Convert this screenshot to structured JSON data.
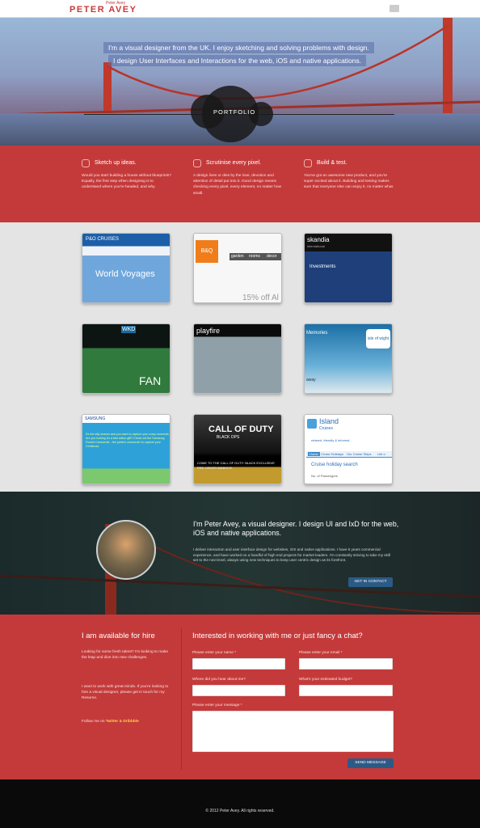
{
  "header": {
    "tagline": "Peter Avey",
    "logo": "PETER AVEY"
  },
  "hero": {
    "line1": "I'm a visual designer from the UK. I enjoy sketching and solving problems with design.",
    "line2": "I design User Interfaces and Interactions for the web, iOS and native applications.",
    "portfolio_label": "PORTFOLIO"
  },
  "features": [
    {
      "title": "Sketch up ideas.",
      "text": "Would you start building a house without blueprints? Equally, the first step when designing is to understand where you're headed, and why."
    },
    {
      "title": "Scrutinise every pixel.",
      "text": "A design lives or dies by the love, devotion and attention of detail put into it. Good design means checking every pixel, every element, no matter how small."
    },
    {
      "title": "Build & test.",
      "text": "You've got an awesome new product, and you're super excited about it. Building and testing makes sure that everyone else can enjoy it, no matter what."
    }
  ],
  "gallery": {
    "po": {
      "brand": "P&O CRUISES",
      "title": "World Voyages"
    },
    "bq": {
      "logo": "B&Q",
      "nav": [
        "garden",
        "rooms",
        "decor"
      ],
      "offer": "15% off Al"
    },
    "skandia": {
      "brand": "skandia",
      "sub": "international",
      "head": "Investments"
    },
    "wkd": {
      "logo": "WKD",
      "banner": "FAN"
    },
    "playfire": {
      "brand": "playfire"
    },
    "wight": {
      "heading": "Memories",
      "badge": "isle of wight",
      "sub": "away"
    },
    "samsung": {
      "brand": "SAMSUNG",
      "text": "It's the silly season and you want to capture your crazy moments. Are you looking for a fast action gift? Check out the Samsung Pocket Camcorder - the perfect camcorder to capture your Christmas."
    },
    "cod": {
      "title": "CALL OF DUTY",
      "sub": "BLACK OPS",
      "band": "COME TO THE CALL OF DUTY: BLACK EXCLUSIVE PRE-ORDER WEBSITE"
    },
    "island": {
      "brand": "Island",
      "brand2": "Cruises",
      "tagline": "relaxed, friendly & informal",
      "tabs": [
        "Home",
        "Cruise Holidays",
        "Our Cruise Ships",
        "Life o"
      ],
      "search": "Cruise holiday search",
      "passengers": "No. of Passengers"
    }
  },
  "about": {
    "heading": "I'm Peter Avey, a visual designer. I design UI and IxD for the web, iOS and native applications.",
    "body": "I deliver interaction and user interface design for websites, iOS and native applications. I have 5 years commercial experience, and have worked on a handful of high end projects for market leaders. I'm constantly striving to take my skill set to the next level, always using new techniques to keep user centric design as its forefront.",
    "button": "GET IN CONTACT"
  },
  "contact": {
    "left_title": "I am available for hire",
    "p1": "Looking for some fresh talent? I'm looking to make the leap and dive into new challenges.",
    "p2": "I want to work with great minds. If you're looking to hire a visual designer, please get in touch for my Resume.",
    "follow_prefix": "Follow me on",
    "follow_links": "Twitter & Dribbble",
    "right_title": "Interested in working with me or just fancy a chat?",
    "labels": {
      "name": "Please enter your name *",
      "email": "Please enter your email *",
      "hear": "Where did you hear about me?",
      "budget": "What's your estimated budget?",
      "message": "Please enter your message *"
    },
    "button": "SEND MESSAGE"
  },
  "footer": {
    "copyright": "© 2012 Peter Avey. All rights reserved."
  }
}
